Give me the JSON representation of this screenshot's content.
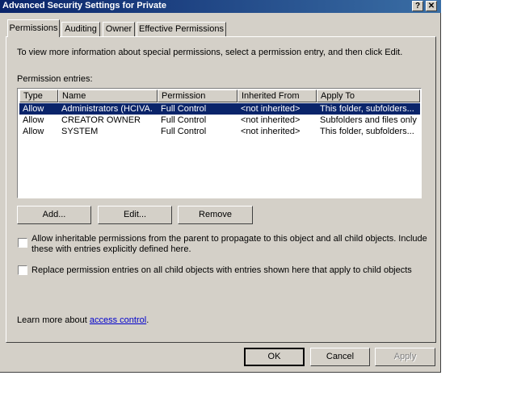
{
  "window": {
    "title": "Advanced Security Settings for Private",
    "help_label": "?",
    "close_label": "✕"
  },
  "tabs": [
    {
      "label": "Permissions"
    },
    {
      "label": "Auditing"
    },
    {
      "label": "Owner"
    },
    {
      "label": "Effective Permissions"
    }
  ],
  "permissions": {
    "intro": "To view more information about special permissions, select a permission entry, and then click Edit.",
    "entries_label": "Permission entries:",
    "columns": [
      "Type",
      "Name",
      "Permission",
      "Inherited From",
      "Apply To"
    ],
    "rows": [
      [
        "Allow",
        "Administrators (HCIVA...",
        "Full Control",
        "<not inherited>",
        "This folder, subfolders..."
      ],
      [
        "Allow",
        "CREATOR OWNER",
        "Full Control",
        "<not inherited>",
        "Subfolders and files only"
      ],
      [
        "Allow",
        "SYSTEM",
        "Full Control",
        "<not inherited>",
        "This folder, subfolders..."
      ]
    ],
    "add_label": "Add...",
    "edit_label": "Edit...",
    "remove_label": "Remove",
    "inherit_checkbox_line1": "Allow inheritable permissions from the parent to propagate to this object and all child objects. Include",
    "inherit_checkbox_line2": "these with entries explicitly defined here.",
    "replace_checkbox": "Replace permission entries on all child objects with entries shown here that apply to child objects",
    "learn_more_prefix": "Learn more about ",
    "learn_more_link": "access control",
    "learn_more_suffix": "."
  },
  "footer": {
    "ok_label": "OK",
    "cancel_label": "Cancel",
    "apply_label": "Apply"
  },
  "colors": {
    "titlebar": "#0a246a",
    "face": "#d4d0c8",
    "selection": "#0a246a",
    "link": "#0000cc"
  }
}
